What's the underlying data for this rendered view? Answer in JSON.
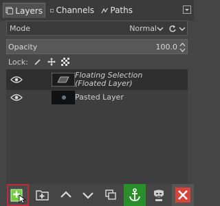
{
  "tabs": [
    {
      "label": "Layers",
      "icon": "layers-icon",
      "active": true
    },
    {
      "label": "Channels",
      "icon": "channels-icon",
      "active": false
    },
    {
      "label": "Paths",
      "icon": "paths-icon",
      "active": false
    }
  ],
  "mode": {
    "label": "Mode",
    "value": "Normal"
  },
  "opacity": {
    "label": "Opacity",
    "value": "100.0"
  },
  "lock": {
    "label": "Lock:"
  },
  "layers": [
    {
      "name_line1": "Floating Selection",
      "name_line2": "(Floated Layer)",
      "visible": true
    },
    {
      "name_line1": "Pasted Layer",
      "name_line2": "",
      "visible": true
    }
  ],
  "toolbar": {
    "buttons": [
      "new-layer",
      "new-layer-group",
      "raise-layer",
      "lower-layer",
      "duplicate-layer",
      "anchor-layer",
      "mask-layer",
      "delete-layer"
    ]
  },
  "colors": {
    "highlight": "#c02a38",
    "anchor_bg": "#2a8f2a",
    "delete": "#d9443a"
  }
}
